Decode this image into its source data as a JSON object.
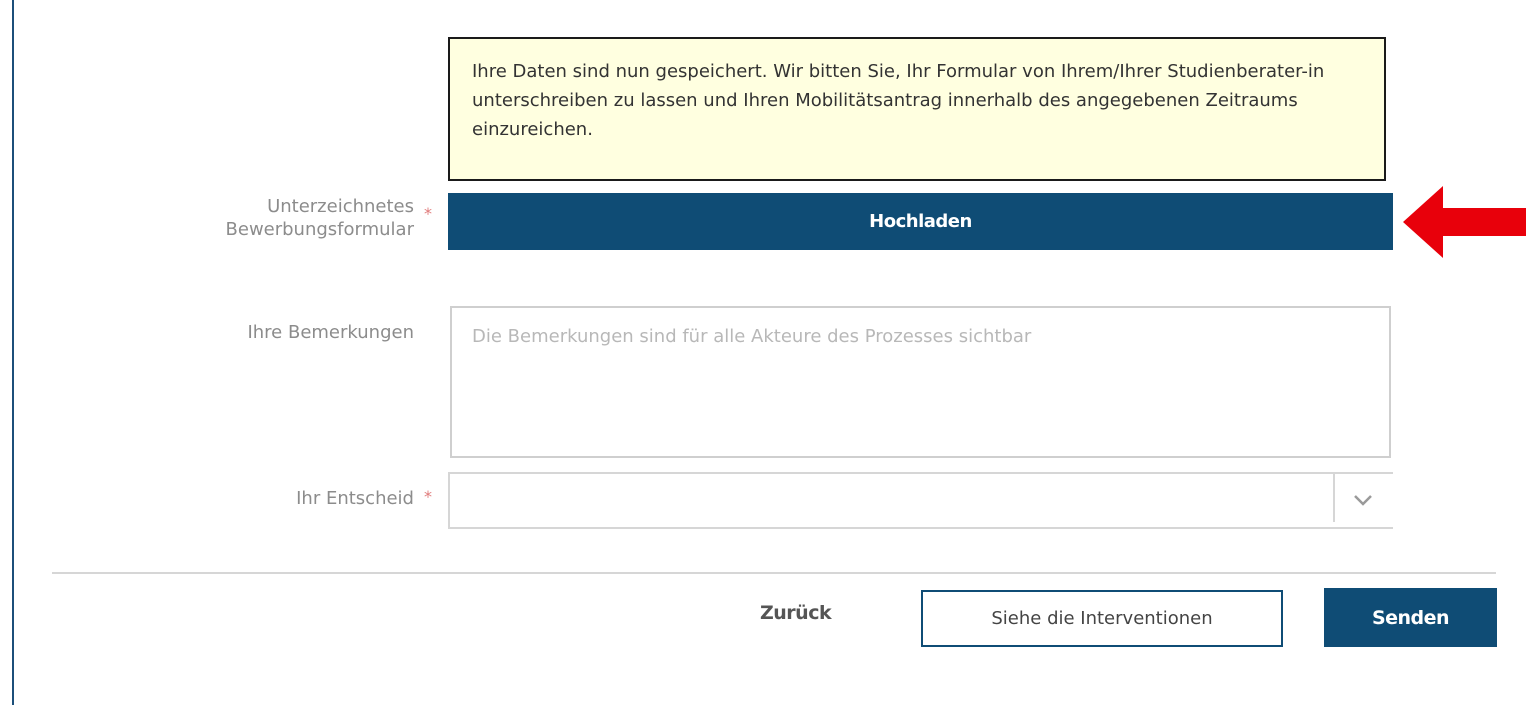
{
  "info_message": "Ihre Daten sind nun gespeichert. Wir bitten Sie, Ihr Formular von Ihrem/Ihrer Studienberater-in unterschreiben zu lassen und Ihren Mobilitätsantrag innerhalb des angegebenen Zeitraums einzureichen.",
  "upload_field": {
    "label_line1": "Unterzeichnetes",
    "label_line2": "Bewerbungsformular",
    "required_marker": "*",
    "button_label": "Hochladen"
  },
  "remarks_field": {
    "label": "Ihre Bemerkungen",
    "value": "",
    "placeholder": "Die Bemerkungen sind für alle Akteure des Prozesses sichtbar"
  },
  "decision_field": {
    "label": "Ihr Entscheid",
    "required_marker": "*",
    "selected_value": "",
    "icon": "chevron-down-icon"
  },
  "actions": {
    "back_label": "Zurück",
    "interventions_label": "Siehe die Interventionen",
    "send_label": "Senden"
  },
  "annotation": {
    "icon": "red-arrow-left-icon",
    "color": "#e8000b"
  },
  "colors": {
    "primary": "#0f4c75",
    "info_background": "#ffffe0",
    "required": "#e07a7a"
  }
}
